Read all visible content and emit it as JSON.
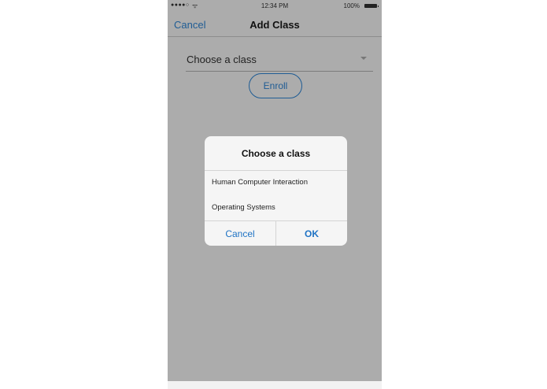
{
  "status_bar": {
    "signal": "●●●●○",
    "wifi": "ᯤ",
    "time": "12:34 PM",
    "battery": "100%"
  },
  "nav": {
    "cancel_label": "Cancel",
    "title": "Add Class"
  },
  "form": {
    "select_value": "Choose a class",
    "enroll_label": "Enroll"
  },
  "dialog": {
    "title": "Choose a class",
    "options": [
      {
        "label": "Human Computer Interaction"
      },
      {
        "label": "Operating Systems"
      }
    ],
    "cancel_label": "Cancel",
    "ok_label": "OK"
  },
  "colors": {
    "accent": "#1f5c94",
    "dialog_button": "#1f73c4",
    "overlay_background": "#acacac"
  },
  "icons": {
    "select_caret": "chevron-down-icon",
    "signal": "signal-icon",
    "wifi": "wifi-icon",
    "battery": "battery-icon"
  }
}
